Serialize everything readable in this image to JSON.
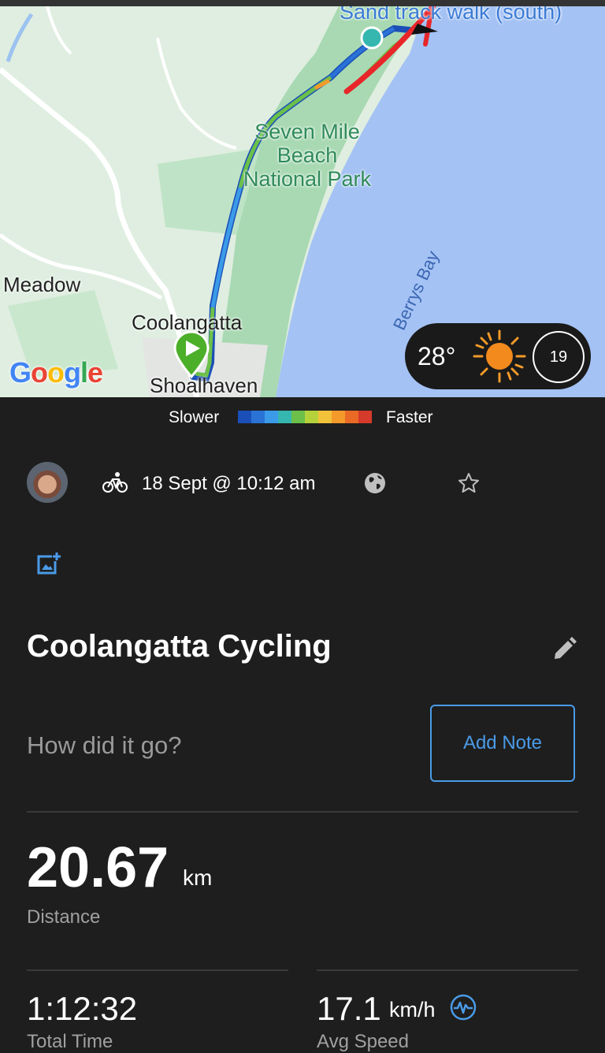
{
  "map": {
    "labels": {
      "top": "Sand track walk (south)",
      "park_line1": "Seven Mile",
      "park_line2": "Beach",
      "park_line3": "National Park",
      "bay": "Berrys Bay",
      "meadow": "Meadow",
      "town": "Coolangatta",
      "region": "Shoalhaven"
    },
    "logo": "Google",
    "weather": {
      "temperature": "28°",
      "icon": "sun-icon",
      "time_badge": "19"
    }
  },
  "legend": {
    "slower": "Slower",
    "faster": "Faster",
    "colors": [
      "#1a4fb8",
      "#2a72d6",
      "#3b9be8",
      "#35b7b0",
      "#6cc04a",
      "#b5d23a",
      "#f2c23a",
      "#f39a2a",
      "#ea6a25",
      "#d63a2a"
    ]
  },
  "activity": {
    "type_icon": "bike-icon",
    "date": "18 Sept @ 10:12 am",
    "privacy_icon": "globe-icon",
    "favorite_icon": "star-icon",
    "add_photo_icon": "add-photo-icon",
    "title": "Coolangatta Cycling",
    "note_prompt": "How did it go?",
    "add_note": "Add Note"
  },
  "stats": {
    "distance": {
      "value": "20.67",
      "unit": "km",
      "label": "Distance"
    },
    "time": {
      "value": "1:12:32",
      "label": "Total Time"
    },
    "speed": {
      "value": "17.1",
      "unit": "km/h",
      "label": "Avg Speed"
    }
  },
  "colors": {
    "accent": "#4a9be8",
    "background": "#1e1e1e",
    "start_marker": "#4caf2a"
  }
}
